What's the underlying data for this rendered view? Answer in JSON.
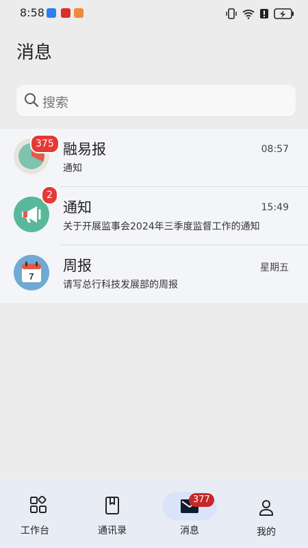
{
  "status_bar": {
    "time": "8:58",
    "app_icons": [
      "link-app-icon",
      "red-app-icon",
      "chat-app-icon"
    ],
    "right_icons": [
      "vibrate-icon",
      "wifi-icon",
      "alert-icon",
      "battery-charging-icon"
    ]
  },
  "header": {
    "title": "消息"
  },
  "search": {
    "placeholder": "搜索"
  },
  "messages": [
    {
      "name": "融易报",
      "time": "08:57",
      "preview": "通知",
      "badge": "375",
      "avatar_color": "#7cc3b0"
    },
    {
      "name": "通知",
      "time": "15:49",
      "preview": "关于开展监事会2024年三季度监督工作的通知",
      "badge": "2",
      "avatar_color": "#5ab89a"
    },
    {
      "name": "周报",
      "time": "星期五",
      "preview": "请写总行科技发展部的周报",
      "badge": "",
      "avatar_color": "#6fa9d4"
    }
  ],
  "bottom_nav": {
    "items": [
      {
        "label": "工作台",
        "icon": "grid-icon"
      },
      {
        "label": "通讯录",
        "icon": "contacts-book-icon"
      },
      {
        "label": "消息",
        "icon": "mail-icon",
        "badge": "377",
        "active": true
      },
      {
        "label": "我的",
        "icon": "person-icon"
      }
    ]
  },
  "colors": {
    "badge_red": "#e53935",
    "active_pill": "#d9e4f8",
    "nav_bg": "#e8edf5",
    "list_bg": "#f4f5f9"
  }
}
